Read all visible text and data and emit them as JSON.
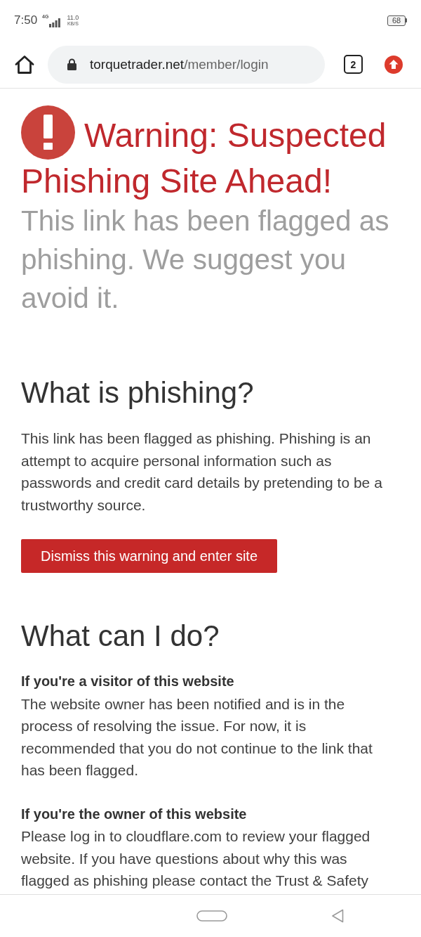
{
  "status_bar": {
    "time": "7:50",
    "network": "4G",
    "speed": {
      "value": "11.0",
      "unit": "KB/S"
    },
    "battery": "68"
  },
  "toolbar": {
    "url": {
      "domain": "torquetrader.net",
      "path": "/member/login"
    },
    "tab_count": "2"
  },
  "warning": {
    "title_lines": [
      "Warning: Suspected",
      "Phishing Site Ahead!"
    ],
    "subtitle": "This link has been flagged as phishing. We suggest you avoid it."
  },
  "sections": [
    {
      "heading": "What is phishing?",
      "blocks": [
        {
          "kind": "paragraph",
          "text": "This link has been flagged as phishing. Phishing is an attempt to acquire personal information such as passwords and credit card details by pretending to be a trustworthy source."
        },
        {
          "kind": "button",
          "label": "Dismiss this warning and enter site"
        }
      ]
    },
    {
      "heading": "What can I do?",
      "blocks": [
        {
          "kind": "note",
          "title": "If you're a visitor of this website",
          "text": "The website owner has been notified and is in the process of resolving the issue. For now, it is recommended that you do not continue to the link that has been flagged."
        },
        {
          "kind": "note",
          "title": "If you're the owner of this website",
          "text": "Please log in to cloudflare.com to review your flagged website. If you have questions about why this was flagged as phishing please contact the Trust & Safety"
        }
      ]
    }
  ]
}
